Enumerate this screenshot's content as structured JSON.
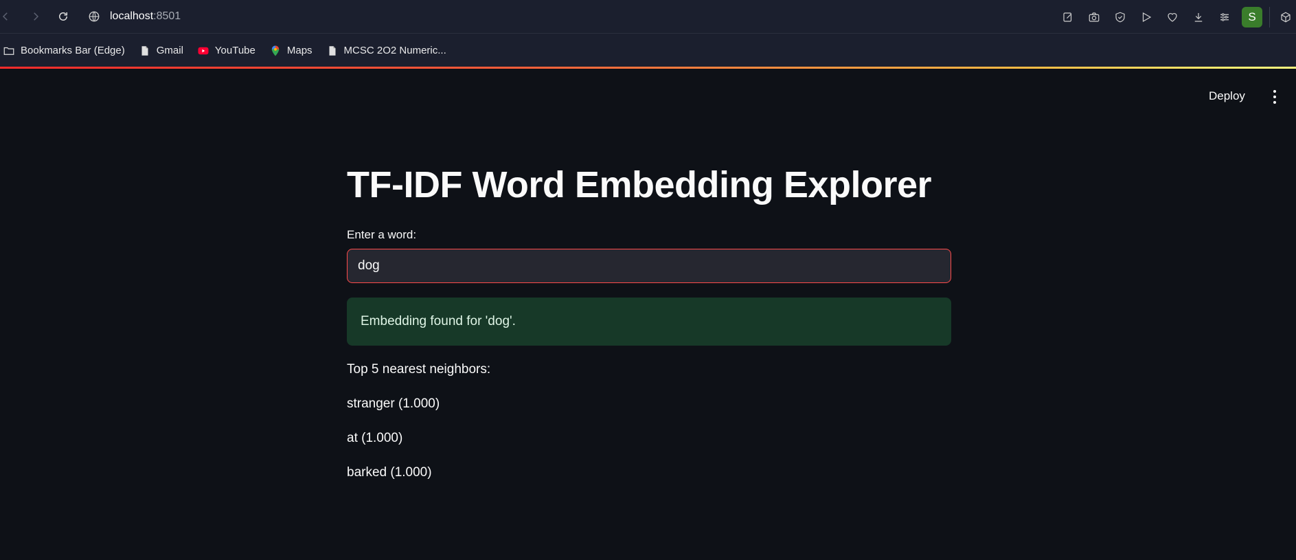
{
  "browser": {
    "url_host": "localhost",
    "url_port": ":8501",
    "profile_initial": "S",
    "bookmarks": [
      {
        "label": "Bookmarks Bar (Edge)",
        "icon": "folder-icon"
      },
      {
        "label": "Gmail",
        "icon": "file-icon"
      },
      {
        "label": "YouTube",
        "icon": "youtube-icon"
      },
      {
        "label": "Maps",
        "icon": "maps-icon"
      },
      {
        "label": "MCSC 2O2 Numeric...",
        "icon": "file-icon"
      }
    ]
  },
  "app": {
    "deploy_label": "Deploy",
    "title": "TF-IDF Word Embedding Explorer",
    "input_label": "Enter a word:",
    "input_value": "dog",
    "success_message": "Embedding found for 'dog'.",
    "neighbors_heading": "Top 5 nearest neighbors:",
    "neighbors": [
      "stranger (1.000)",
      "at (1.000)",
      "barked (1.000)"
    ]
  },
  "colors": {
    "background": "#0e1117",
    "accent": "#ff4b4b",
    "success_bg": "#173928",
    "input_bg": "#262730"
  }
}
